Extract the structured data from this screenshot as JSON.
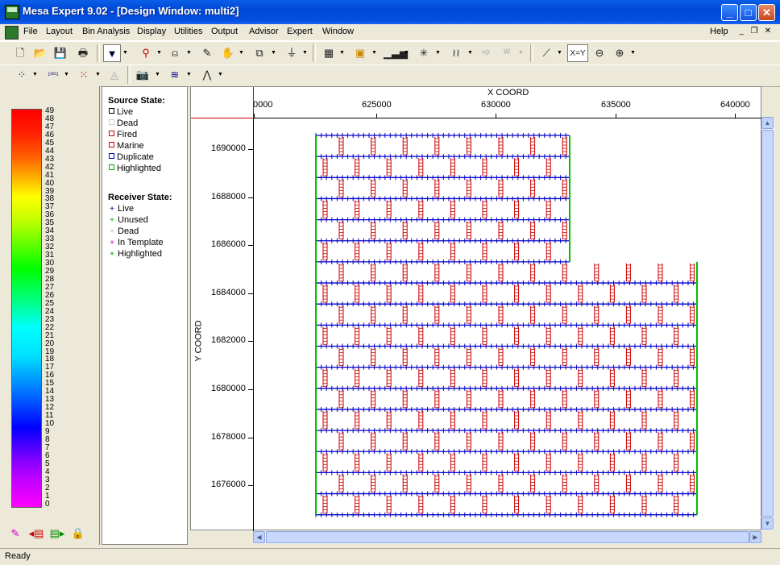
{
  "window": {
    "title": "Mesa Expert 9.02 - [Design Window: multi2]"
  },
  "menubar": {
    "items": [
      "File",
      "Layout",
      "Bin Analysis",
      "Display",
      "Utilities",
      "Output",
      "Advisor",
      "Expert",
      "Window"
    ],
    "help": "Help"
  },
  "toolbar": {
    "xy_label": "X=Y"
  },
  "colorbar": {
    "labels": [
      "49",
      "48",
      "47",
      "46",
      "45",
      "44",
      "43",
      "42",
      "41",
      "40",
      "39",
      "38",
      "37",
      "36",
      "35",
      "34",
      "33",
      "32",
      "31",
      "30",
      "29",
      "28",
      "27",
      "26",
      "25",
      "24",
      "23",
      "22",
      "21",
      "20",
      "19",
      "18",
      "17",
      "16",
      "15",
      "14",
      "13",
      "12",
      "11",
      "10",
      "9",
      "8",
      "7",
      "6",
      "5",
      "4",
      "3",
      "2",
      "1",
      "0"
    ]
  },
  "legend": {
    "source_title": "Source State:",
    "source_items": [
      {
        "label": "Live",
        "color": "#000000"
      },
      {
        "label": "Dead",
        "color": "#d0d0d0"
      },
      {
        "label": "Fired",
        "color": "#cc0000"
      },
      {
        "label": "Marine",
        "color": "#cc0000"
      },
      {
        "label": "Duplicate",
        "color": "#0000cc"
      },
      {
        "label": "Highlighted",
        "color": "#00aa00"
      }
    ],
    "receiver_title": "Receiver State:",
    "receiver_items": [
      {
        "label": "Live",
        "color": "#000080"
      },
      {
        "label": "Unused",
        "color": "#00aa00"
      },
      {
        "label": "Dead",
        "color": "#c0c0c0"
      },
      {
        "label": "In Template",
        "color": "#cc00cc"
      },
      {
        "label": "Highlighted",
        "color": "#00aa00"
      }
    ]
  },
  "plot": {
    "x_title": "X COORD",
    "y_title": "Y COORD",
    "x_ticks": [
      "0000",
      "625000",
      "630000",
      "635000",
      "640000"
    ],
    "y_ticks": [
      "1690000",
      "1688000",
      "1686000",
      "1684000",
      "1682000",
      "1680000",
      "1678000",
      "1676000"
    ]
  },
  "status": {
    "text": "Ready"
  }
}
